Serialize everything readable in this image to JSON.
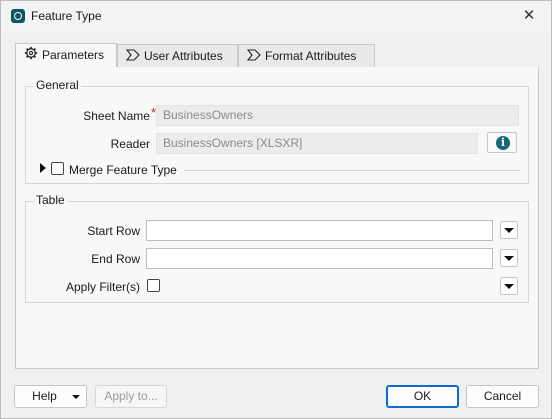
{
  "window": {
    "title": "Feature Type"
  },
  "tabs": [
    {
      "label": "Parameters",
      "icon": "gear-icon",
      "active": true
    },
    {
      "label": "User Attributes",
      "icon": "attribute-arrow-icon",
      "active": false
    },
    {
      "label": "Format Attributes",
      "icon": "attribute-arrow-icon",
      "active": false
    }
  ],
  "general": {
    "title": "General",
    "sheet_name_label": "Sheet Name",
    "required_marker": "*",
    "sheet_name_value": "BusinessOwners",
    "reader_label": "Reader",
    "reader_value": "BusinessOwners [XLSXR]",
    "info_glyph": "i",
    "merge_label": "Merge Feature Type",
    "merge_checked": false
  },
  "table": {
    "title": "Table",
    "start_row_label": "Start Row",
    "start_row_value": "",
    "end_row_label": "End Row",
    "end_row_value": "",
    "apply_filter_label": "Apply Filter(s)",
    "apply_filter_checked": false
  },
  "footer": {
    "help_label": "Help",
    "apply_to_label": "Apply to...",
    "ok_label": "OK",
    "cancel_label": "Cancel"
  },
  "colors": {
    "accent": "#0a6ad6",
    "required": "#c0262b",
    "info_icon": "#136a7a"
  }
}
